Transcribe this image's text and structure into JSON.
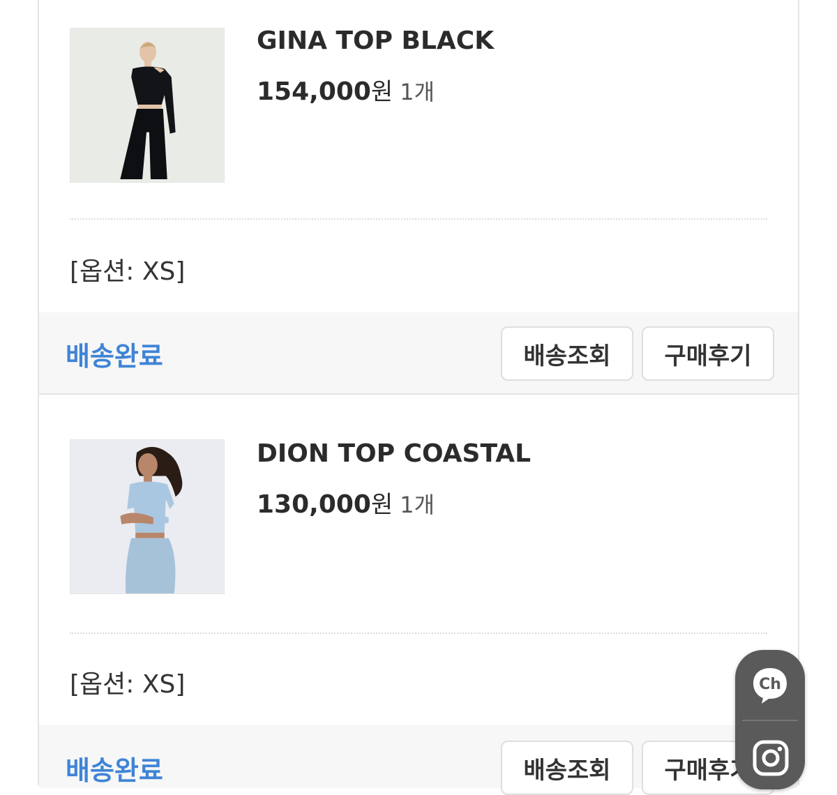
{
  "orders": [
    {
      "product_name": "GINA TOP BLACK",
      "price": "154,000",
      "currency": "원",
      "quantity": "1개",
      "option": "[옵션: XS]",
      "status": "배송완료",
      "track_button": "배송조회",
      "review_button": "구매후기",
      "thumbnail_icon": "product-photo-black-top"
    },
    {
      "product_name": "DION TOP COASTAL",
      "price": "130,000",
      "currency": "원",
      "quantity": "1개",
      "option": "[옵션: XS]",
      "status": "배송완료",
      "track_button": "배송조회",
      "review_button": "구매후기",
      "thumbnail_icon": "product-photo-blue-top"
    }
  ],
  "floating_widget": {
    "channel_label": "Ch",
    "channel_icon": "kakao-channel-icon",
    "instagram_icon": "instagram-icon"
  },
  "colors": {
    "status_blue": "#3f84d6",
    "widget_bg": "#5a5a5a"
  }
}
